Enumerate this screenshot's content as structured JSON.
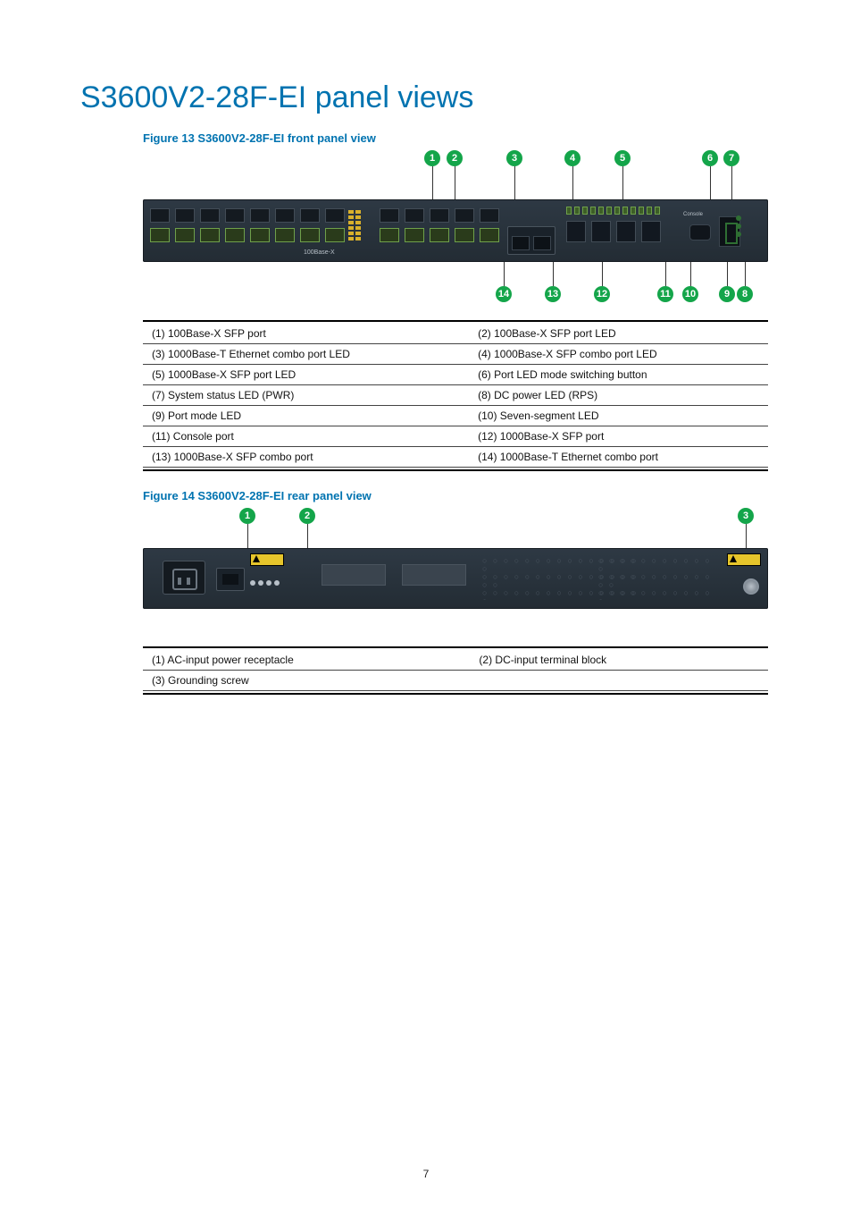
{
  "page_title": "S3600V2-28F-EI panel views",
  "page_number": "7",
  "figures": {
    "front": {
      "caption": "Figure 13 S3600V2-28F-EI front panel view",
      "callouts": [
        "1",
        "2",
        "3",
        "4",
        "5",
        "6",
        "7",
        "8",
        "9",
        "10",
        "11",
        "12",
        "13",
        "14"
      ],
      "chassis_text": "100Base-X",
      "console_label": "Console"
    },
    "rear": {
      "caption": "Figure 14 S3600V2-28F-EI rear panel view",
      "callouts": [
        "1",
        "2",
        "3"
      ]
    }
  },
  "front_legend": [
    {
      "l": "(1) 100Base-X SFP port",
      "r": "(2) 100Base-X SFP port LED"
    },
    {
      "l": "(3) 1000Base-T Ethernet combo port LED",
      "r": "(4) 1000Base-X SFP combo port LED"
    },
    {
      "l": "(5) 1000Base-X SFP port LED",
      "r": "(6) Port LED mode switching button"
    },
    {
      "l": "(7) System status LED (PWR)",
      "r": "(8) DC power LED (RPS)"
    },
    {
      "l": "(9) Port mode LED",
      "r": "(10) Seven-segment LED"
    },
    {
      "l": "(11) Console port",
      "r": "(12) 1000Base-X SFP port"
    },
    {
      "l": "(13) 1000Base-X SFP combo port",
      "r": "(14) 1000Base-T Ethernet combo port"
    }
  ],
  "rear_legend": [
    {
      "l": "(1) AC-input power receptacle",
      "r": "(2) DC-input terminal block"
    },
    {
      "l": "(3) Grounding screw",
      "r": ""
    }
  ]
}
